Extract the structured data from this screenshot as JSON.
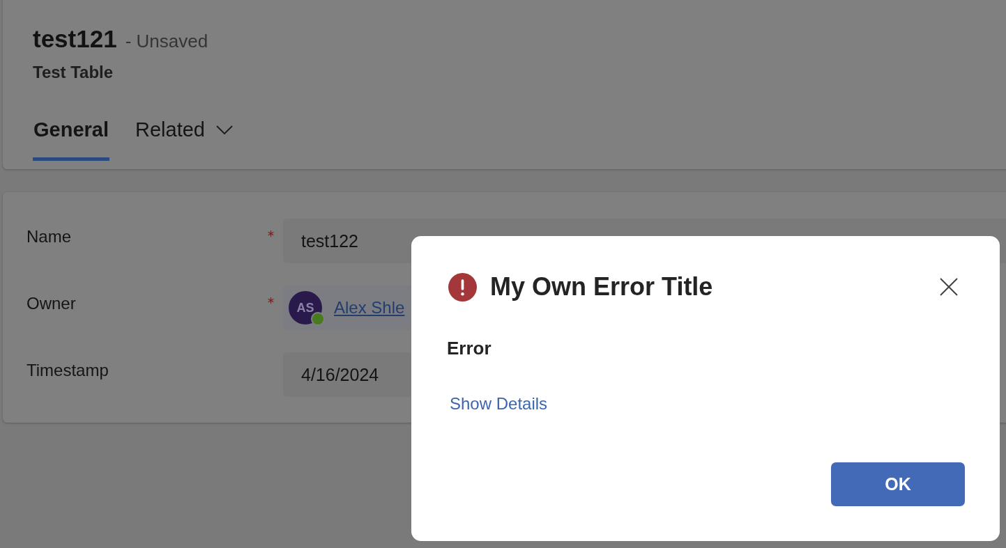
{
  "record": {
    "title": "test121",
    "status": "- Unsaved",
    "entity": "Test Table"
  },
  "tabs": [
    {
      "label": "General",
      "selected": true,
      "kind": "plain"
    },
    {
      "label": "Related",
      "selected": false,
      "kind": "dropdown"
    }
  ],
  "form": {
    "fields": [
      {
        "label": "Name",
        "required": true,
        "kind": "text",
        "value": "test122"
      },
      {
        "label": "Owner",
        "required": true,
        "kind": "lookup",
        "initials": "AS",
        "value": "Alex Shle"
      },
      {
        "label": "Timestamp",
        "required": false,
        "kind": "date",
        "value": "4/16/2024"
      }
    ]
  },
  "dialog": {
    "title": "My Own Error Title",
    "message": "Error",
    "link": "Show Details",
    "buttons": [
      "OK"
    ]
  }
}
